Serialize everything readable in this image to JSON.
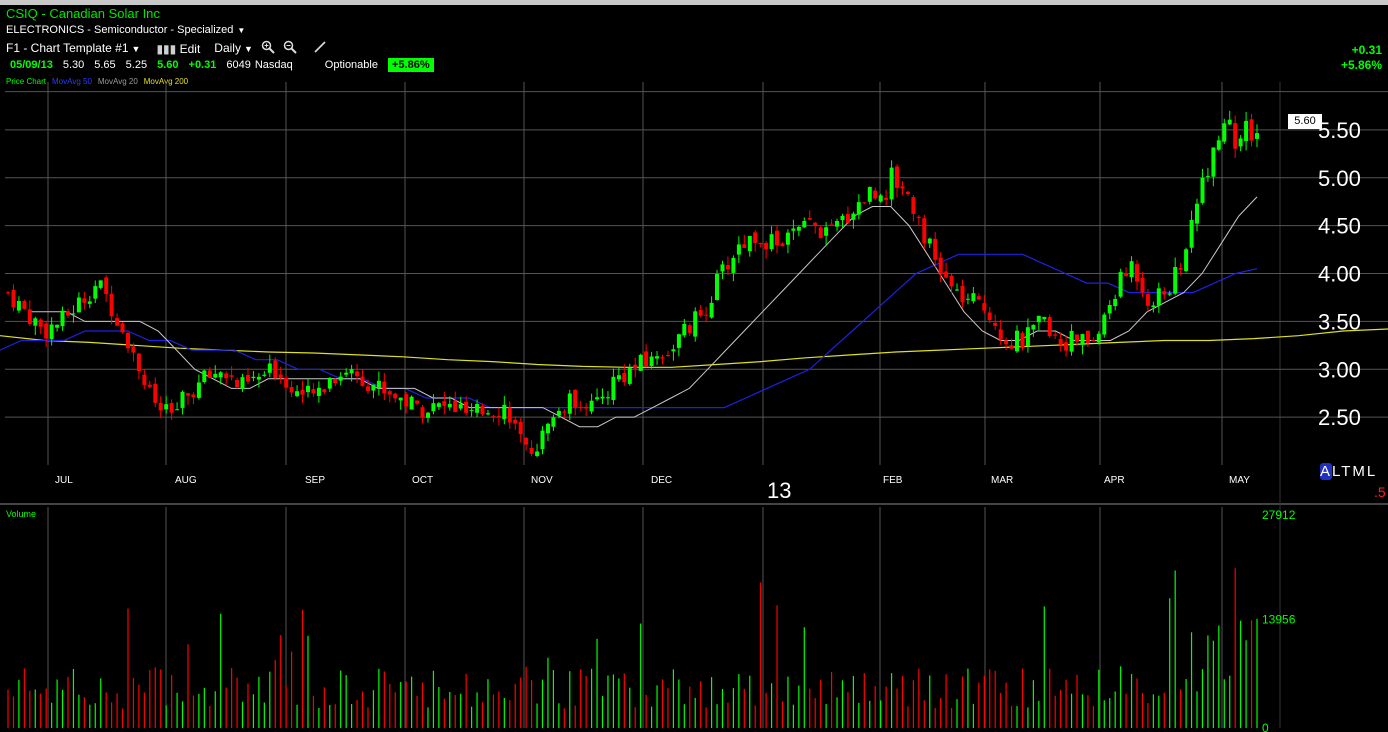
{
  "header": {
    "title": "CSIQ - Canadian Solar Inc",
    "industry": "ELECTRONICS - Semiconductor - Specialized",
    "template": "F1 - Chart Template #1",
    "edit_label": "Edit",
    "period": "Daily"
  },
  "quote": {
    "date": "05/09/13",
    "open": "5.30",
    "high": "5.65",
    "low": "5.25",
    "last": "5.60",
    "change": "+0.31",
    "volume": "6049",
    "exchange": "Nasdaq",
    "optionable": "Optionable",
    "change_pct": "+5.86%"
  },
  "right_change": {
    "abs": "+0.31",
    "pct": "+5.86%"
  },
  "price_box": "5.60",
  "legend": {
    "price": "Price Chart",
    "ma50": "MovAvg 50",
    "ma20": "MovAvg 20",
    "ma200": "MovAvg 200"
  },
  "altml": {
    "a": "A",
    "rest": "LTML"
  },
  "dot5": ".5",
  "colors": {
    "up": "#00ff00",
    "down": "#ff0000",
    "ma50": "#2020e0",
    "ma20": "#c8c8c8",
    "ma200": "#e0e020",
    "grid": "#555555"
  },
  "chart_data": [
    {
      "type": "candlestick",
      "ylim": [
        2.0,
        6.0
      ],
      "y_ticks": [
        "5.50",
        "5.00",
        "4.50",
        "4.00",
        "3.50",
        "3.00",
        "2.50"
      ],
      "y_tick_values": [
        5.5,
        5.0,
        4.5,
        4.0,
        3.5,
        3.0,
        2.5
      ],
      "x_month_labels": [
        "JUL",
        "AUG",
        "SEP",
        "OCT",
        "NOV",
        "DEC",
        "FEB",
        "MAR",
        "APR",
        "MAY"
      ],
      "x_year_label": "13",
      "closes_weekly": [
        3.8,
        3.6,
        3.4,
        3.5,
        3.7,
        3.9,
        3.6,
        3.2,
        2.7,
        2.5,
        2.7,
        2.9,
        3.0,
        2.8,
        2.9,
        3.0,
        2.8,
        2.7,
        2.9,
        3.0,
        2.9,
        2.8,
        2.7,
        2.6,
        2.6,
        2.6,
        2.5,
        2.6,
        2.6,
        2.1,
        2.3,
        2.6,
        2.7,
        2.6,
        2.9,
        3.0,
        3.1,
        3.2,
        3.4,
        3.6,
        4.0,
        4.3,
        4.4,
        4.3,
        4.4,
        4.5,
        4.4,
        4.6,
        4.8,
        4.9,
        5.0,
        4.6,
        4.1,
        3.8,
        3.7,
        3.6,
        3.3,
        3.3,
        3.5,
        3.3,
        3.3,
        3.3,
        3.8,
        4.1,
        3.7,
        3.8,
        4.2,
        5.0,
        5.6,
        5.4,
        5.6
      ],
      "ma20_weekly": [
        3.6,
        3.6,
        3.6,
        3.5,
        3.5,
        3.5,
        3.5,
        3.4,
        3.2,
        3.0,
        2.9,
        2.8,
        2.8,
        2.9,
        2.9,
        2.9,
        2.9,
        2.9,
        2.9,
        2.8,
        2.8,
        2.8,
        2.7,
        2.7,
        2.6,
        2.6,
        2.6,
        2.6,
        2.6,
        2.5,
        2.4,
        2.4,
        2.5,
        2.5,
        2.6,
        2.7,
        2.8,
        3.0,
        3.2,
        3.4,
        3.6,
        3.8,
        4.0,
        4.2,
        4.4,
        4.6,
        4.7,
        4.7,
        4.5,
        4.2,
        3.9,
        3.6,
        3.4,
        3.3,
        3.3,
        3.4,
        3.4,
        3.3,
        3.3,
        3.3,
        3.4,
        3.6,
        3.7,
        3.8,
        4.0,
        4.3,
        4.6,
        4.8
      ],
      "ma50_weekly": [
        3.2,
        3.3,
        3.3,
        3.3,
        3.4,
        3.4,
        3.4,
        3.3,
        3.3,
        3.2,
        3.2,
        3.2,
        3.1,
        3.1,
        3.0,
        3.0,
        2.9,
        2.9,
        2.8,
        2.8,
        2.7,
        2.7,
        2.7,
        2.6,
        2.6,
        2.6,
        2.6,
        2.6,
        2.6,
        2.6,
        2.6,
        2.6,
        2.6,
        2.6,
        2.6,
        2.7,
        2.8,
        2.9,
        3.0,
        3.2,
        3.4,
        3.6,
        3.8,
        4.0,
        4.1,
        4.2,
        4.2,
        4.2,
        4.2,
        4.1,
        4.0,
        3.9,
        3.9,
        3.8,
        3.8,
        3.8,
        3.8,
        3.9,
        4.0,
        4.05
      ],
      "ma200_weekly": [
        3.35,
        3.3,
        3.28,
        3.25,
        3.22,
        3.2,
        3.18,
        3.17,
        3.15,
        3.13,
        3.1,
        3.08,
        3.05,
        3.03,
        3.02,
        3.02,
        3.05,
        3.08,
        3.12,
        3.15,
        3.18,
        3.2,
        3.22,
        3.24,
        3.26,
        3.28,
        3.3,
        3.3,
        3.32,
        3.35,
        3.4,
        3.42
      ]
    },
    {
      "type": "bar",
      "title": "Volume",
      "ylim": [
        0,
        27912
      ],
      "y_ticks": [
        "27912",
        "13956",
        "0"
      ],
      "y_tick_values": [
        27912,
        13956,
        0
      ]
    }
  ]
}
